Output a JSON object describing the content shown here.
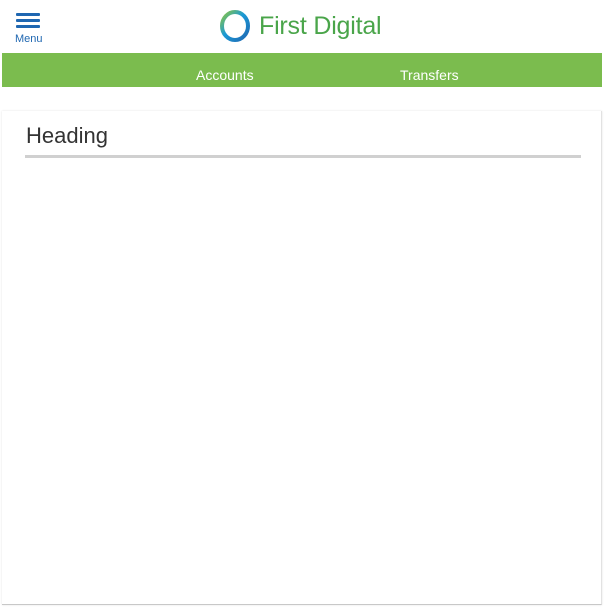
{
  "header": {
    "menu_label": "Menu",
    "menu_icon": "hamburger-icon",
    "logo_text": "First Digital",
    "logo_icon": "ring-logo-icon"
  },
  "nav": {
    "items": [
      {
        "label": "Accounts"
      },
      {
        "label": "Transfers"
      }
    ]
  },
  "main": {
    "heading": "Heading"
  },
  "colors": {
    "brand_blue": "#1f67b1",
    "brand_green": "#7bbc4e",
    "logo_green": "#4aa54a"
  }
}
